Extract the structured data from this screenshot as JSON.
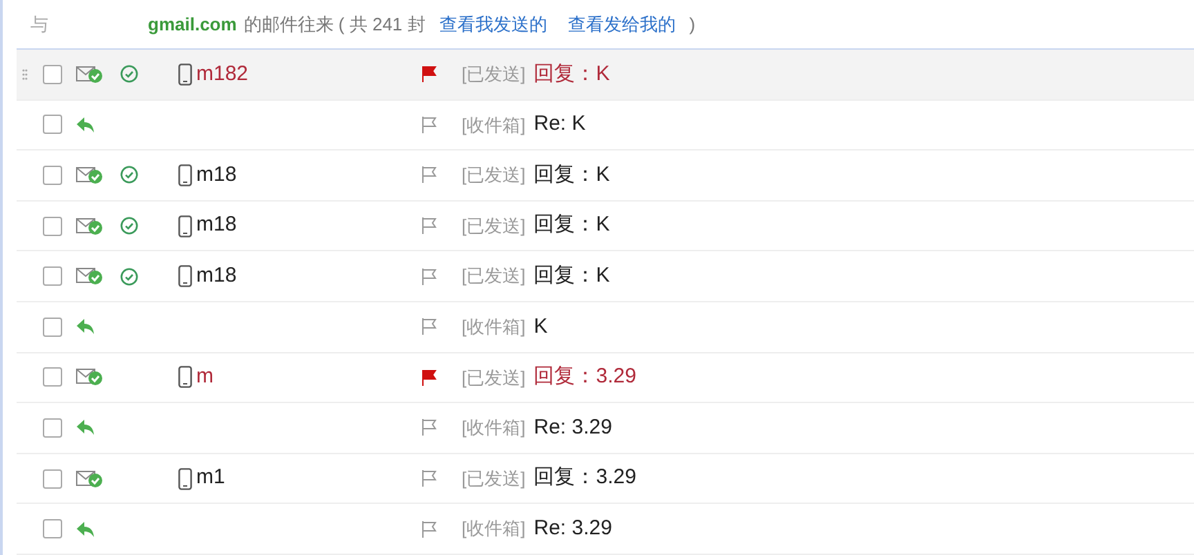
{
  "header": {
    "prefix": "与",
    "address": "gmail.com",
    "text": "的邮件往来 ( 共 241 封",
    "links": [
      "查看我发送的",
      "查看发给我的"
    ],
    "close": ")"
  },
  "rows": [
    {
      "kind": "sent",
      "selected": true,
      "checked": false,
      "receipt": true,
      "sender": "m182",
      "flagged": true,
      "folder": "[已发送]",
      "subject": "回复：K"
    },
    {
      "kind": "inbox",
      "selected": false,
      "checked": false,
      "receipt": false,
      "flagged": false,
      "folder": "[收件箱]",
      "subject": "Re: K"
    },
    {
      "kind": "sent",
      "selected": false,
      "checked": false,
      "receipt": true,
      "sender": "m18",
      "flagged": false,
      "folder": "[已发送]",
      "subject": "回复：K"
    },
    {
      "kind": "sent",
      "selected": false,
      "checked": false,
      "receipt": true,
      "sender": "m18",
      "flagged": false,
      "folder": "[已发送]",
      "subject": "回复：K"
    },
    {
      "kind": "sent",
      "selected": false,
      "checked": false,
      "receipt": true,
      "sender": "m18",
      "flagged": false,
      "folder": "[已发送]",
      "subject": "回复：K"
    },
    {
      "kind": "inbox",
      "selected": false,
      "checked": false,
      "receipt": false,
      "flagged": false,
      "folder": "[收件箱]",
      "subject": "K"
    },
    {
      "kind": "sent",
      "selected": false,
      "checked": false,
      "receipt": false,
      "sender": "m",
      "flagged": true,
      "folder": "[已发送]",
      "subject": "回复：3.29"
    },
    {
      "kind": "inbox",
      "selected": false,
      "checked": false,
      "receipt": false,
      "flagged": false,
      "folder": "[收件箱]",
      "subject": "Re: 3.29"
    },
    {
      "kind": "sent",
      "selected": false,
      "checked": false,
      "receipt": false,
      "sender": "m1",
      "flagged": false,
      "folder": "[已发送]",
      "subject": "回复：3.29"
    },
    {
      "kind": "inbox",
      "selected": false,
      "checked": false,
      "receipt": false,
      "flagged": false,
      "folder": "[收件箱]",
      "subject": "Re: 3.29"
    }
  ]
}
